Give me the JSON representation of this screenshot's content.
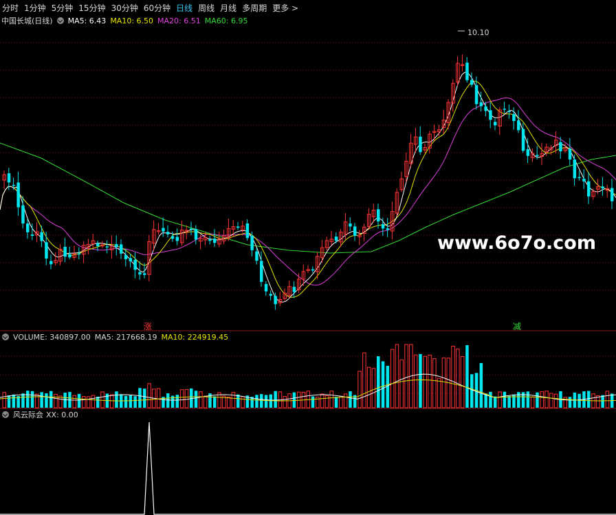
{
  "toolbar": {
    "tabs": [
      "分时",
      "1分钟",
      "5分钟",
      "15分钟",
      "30分钟",
      "60分钟",
      "日线",
      "周线",
      "月线",
      "多周期",
      "更多 >"
    ],
    "active_tab": "日线"
  },
  "main_panel": {
    "title": "中国长城(日线)",
    "ma5": "MA5: 6.43",
    "ma10": "MA10: 6.50",
    "ma20": "MA20: 6.51",
    "ma60": "MA60: 6.95",
    "peak_label": "10.10",
    "watermark": "www.6o7o.com",
    "marker_up": "涨",
    "marker_down": "减"
  },
  "volume_panel": {
    "volume": "VOLUME: 340897.00",
    "ma5": "MA5: 217668.19",
    "ma10": "MA10: 224919.45"
  },
  "indicator_panel": {
    "name": "风云际会",
    "xx": "XX: 0.00"
  },
  "colors": {
    "up": "#ff3333",
    "down": "#00e5ee",
    "ma5": "#ffffff",
    "ma10": "#e6e600",
    "ma20": "#e040e0",
    "ma60": "#33dd33",
    "active_tab": "#37c3f0"
  }
}
